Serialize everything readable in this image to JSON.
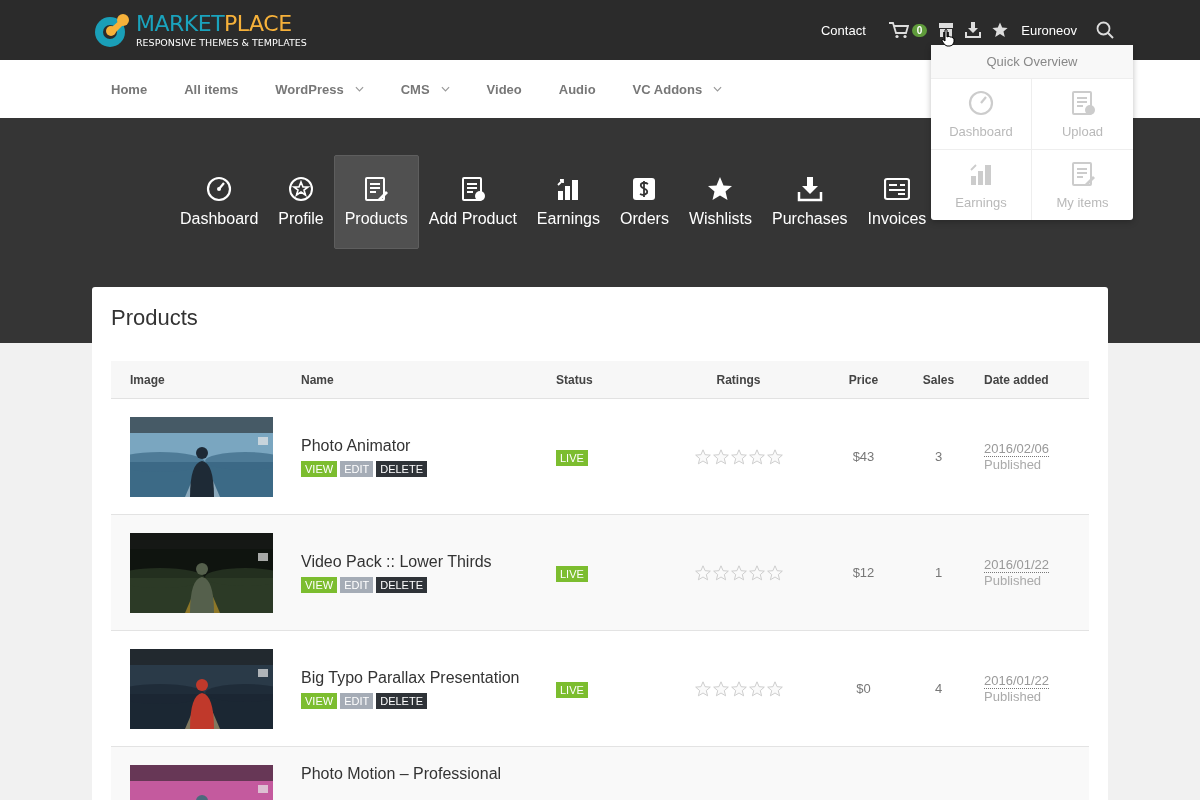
{
  "logo": {
    "word_1": "MARKET",
    "word_2": "PLACE",
    "tagline": "RESPONSIVE THEMES & TEMPLATES"
  },
  "top_bar": {
    "contact": "Contact",
    "cart_count": "0",
    "user": "Euroneov"
  },
  "main_nav": [
    {
      "label": "Home",
      "has_menu": false
    },
    {
      "label": "All items",
      "has_menu": false
    },
    {
      "label": "WordPress",
      "has_menu": true
    },
    {
      "label": "CMS",
      "has_menu": true
    },
    {
      "label": "Video",
      "has_menu": false
    },
    {
      "label": "Audio",
      "has_menu": false
    },
    {
      "label": "VC Addons",
      "has_menu": true
    }
  ],
  "dashboard_nav": [
    {
      "label": "Dashboard",
      "kind": "gauge",
      "selected": false
    },
    {
      "label": "Profile",
      "kind": "badge",
      "selected": false
    },
    {
      "label": "Products",
      "kind": "list-edit",
      "selected": true
    },
    {
      "label": "Add Product",
      "kind": "list-add",
      "selected": false
    },
    {
      "label": "Earnings",
      "kind": "bars",
      "selected": false
    },
    {
      "label": "Orders",
      "kind": "dollar",
      "selected": false
    },
    {
      "label": "Wishlists",
      "kind": "star",
      "selected": false
    },
    {
      "label": "Purchases",
      "kind": "download",
      "selected": false
    },
    {
      "label": "Invoices",
      "kind": "invoice",
      "selected": false
    }
  ],
  "quick_overview": {
    "title": "Quick Overview",
    "tiles": [
      {
        "label": "Dashboard",
        "kind": "gauge"
      },
      {
        "label": "Upload",
        "kind": "list-add"
      },
      {
        "label": "Earnings",
        "kind": "bars"
      },
      {
        "label": "My items",
        "kind": "list-edit"
      }
    ]
  },
  "page_title": "Products",
  "table": {
    "columns": [
      "Image",
      "Name",
      "Status",
      "Ratings",
      "Price",
      "Sales",
      "Date added"
    ],
    "rows": [
      {
        "image": {
          "kind": "picture"
        },
        "name": "Photo Animator",
        "actions": [
          "VIEW",
          "EDIT",
          "DELETE"
        ],
        "status": {
          "label": "LIVE",
          "kind": "live"
        },
        "stars": 0,
        "price": "$43",
        "sales": "3",
        "date": "2016/02/06",
        "state": "Published"
      },
      {
        "image": {
          "kind": "picture"
        },
        "name": "Video Pack :: Lower Thirds",
        "actions": [
          "VIEW",
          "EDIT",
          "DELETE"
        ],
        "status": {
          "label": "LIVE",
          "kind": "live"
        },
        "stars": 0,
        "price": "$12",
        "sales": "1",
        "date": "2016/01/22",
        "state": "Published"
      },
      {
        "image": {
          "kind": "picture"
        },
        "name": "Big Typo Parallax Presentation",
        "actions": [
          "VIEW",
          "EDIT",
          "DELETE"
        ],
        "status": {
          "label": "LIVE",
          "kind": "live"
        },
        "stars": 0,
        "price": "$0",
        "sales": "4",
        "date": "2016/01/22",
        "state": "Published"
      },
      {
        "image": {
          "kind": "picture"
        },
        "name": "Photo Motion – Professional"
      }
    ]
  }
}
